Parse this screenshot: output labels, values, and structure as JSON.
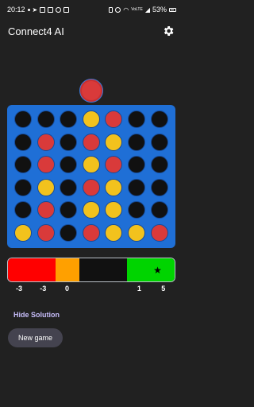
{
  "status_bar": {
    "time": "20:12",
    "battery": "53%",
    "network": "VoLTE"
  },
  "app_bar": {
    "title": "Connect4 AI",
    "settings_icon": "gear-icon"
  },
  "current_piece": "red",
  "board": {
    "rows": 6,
    "cols": 7,
    "cells": [
      [
        "e",
        "e",
        "e",
        "y",
        "r",
        "e",
        "e"
      ],
      [
        "e",
        "r",
        "e",
        "r",
        "y",
        "e",
        "e"
      ],
      [
        "e",
        "r",
        "e",
        "y",
        "r",
        "e",
        "e"
      ],
      [
        "e",
        "y",
        "e",
        "r",
        "y",
        "e",
        "e"
      ],
      [
        "e",
        "r",
        "e",
        "y",
        "y",
        "e",
        "e"
      ],
      [
        "y",
        "r",
        "e",
        "r",
        "y",
        "y",
        "r"
      ]
    ],
    "colors": {
      "board": "#1f6fd6",
      "red": "#d93a3a",
      "yellow": "#f2c21d",
      "empty": "#111111"
    }
  },
  "evaluation": {
    "scores": [
      "-3",
      "-3",
      "0",
      "",
      "",
      "1",
      "5"
    ],
    "segments": [
      {
        "color": "#ff0000",
        "span": 2
      },
      {
        "color": "#ffa000",
        "span": 1
      },
      {
        "color": "#111111",
        "span": 2
      },
      {
        "color": "#00d400",
        "span": 2
      }
    ],
    "best_column_marker": "★"
  },
  "buttons": {
    "hide_solution": "Hide Solution",
    "new_game": "New game"
  }
}
